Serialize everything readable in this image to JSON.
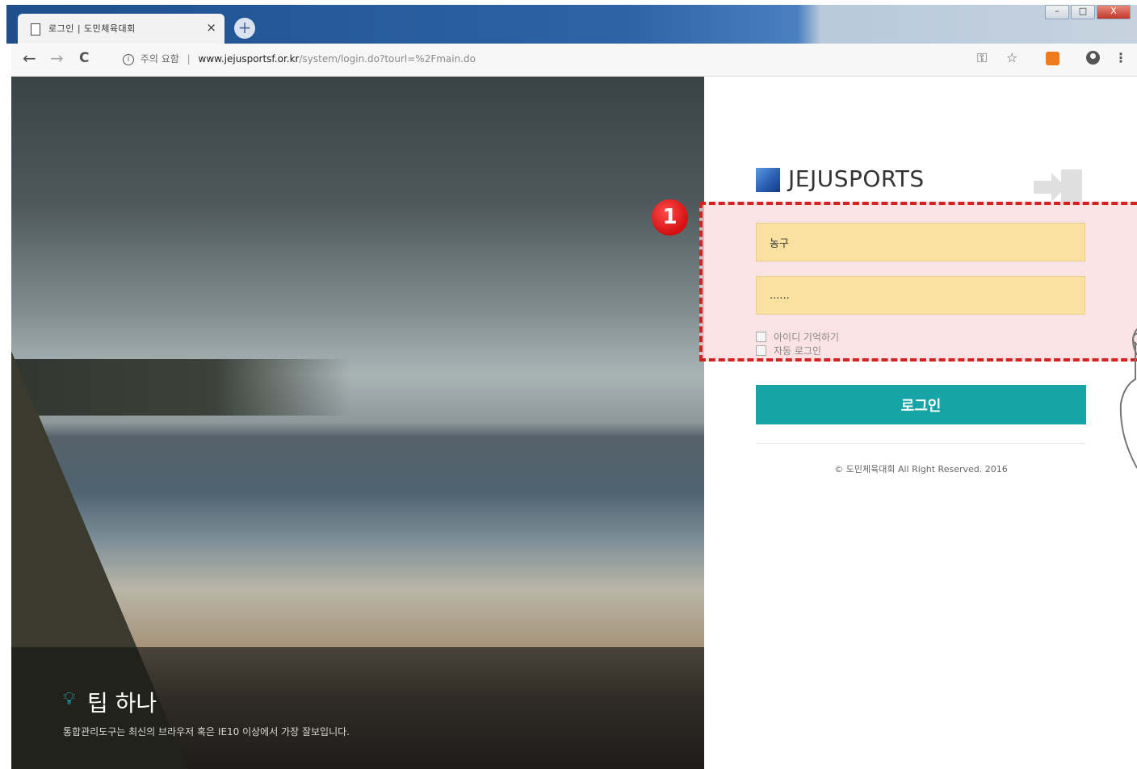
{
  "browser": {
    "tab_title": "로그인 | 도민체육대회",
    "tab_close": "×",
    "new_tab": "+",
    "window_controls": [
      "–",
      "□",
      "X"
    ],
    "nav": {
      "back": "←",
      "forward": "→",
      "reload": "C"
    },
    "security_label": "주의 요함",
    "url_host": "www.jejusportsf.or.kr",
    "url_path": "/system/login.do?tourl=%2Fmain.do",
    "toolbar_icons": [
      "key-icon",
      "star-icon",
      "extension-icon",
      "profile-icon",
      "menu-icon"
    ]
  },
  "tip": {
    "title": "팁 하나",
    "text": "통합관리도구는 최신의 브라우저 혹은 IE10 이상에서 가장 잘보입니다."
  },
  "login": {
    "brand": "JEJUSPORTS",
    "badge_number": "1",
    "username_value": "농구",
    "password_value": "......",
    "remember_id_label": "아이디 기억하기",
    "auto_login_label": "자동 로그인",
    "submit_label": "로그인",
    "copyright": "© 도민체육대회 All Right Reserved. 2016"
  },
  "colors": {
    "accent": "#17a4a6",
    "field_bg": "#fae1a2",
    "highlight_border": "#d32222",
    "highlight_fill": "#f9d7d9"
  }
}
